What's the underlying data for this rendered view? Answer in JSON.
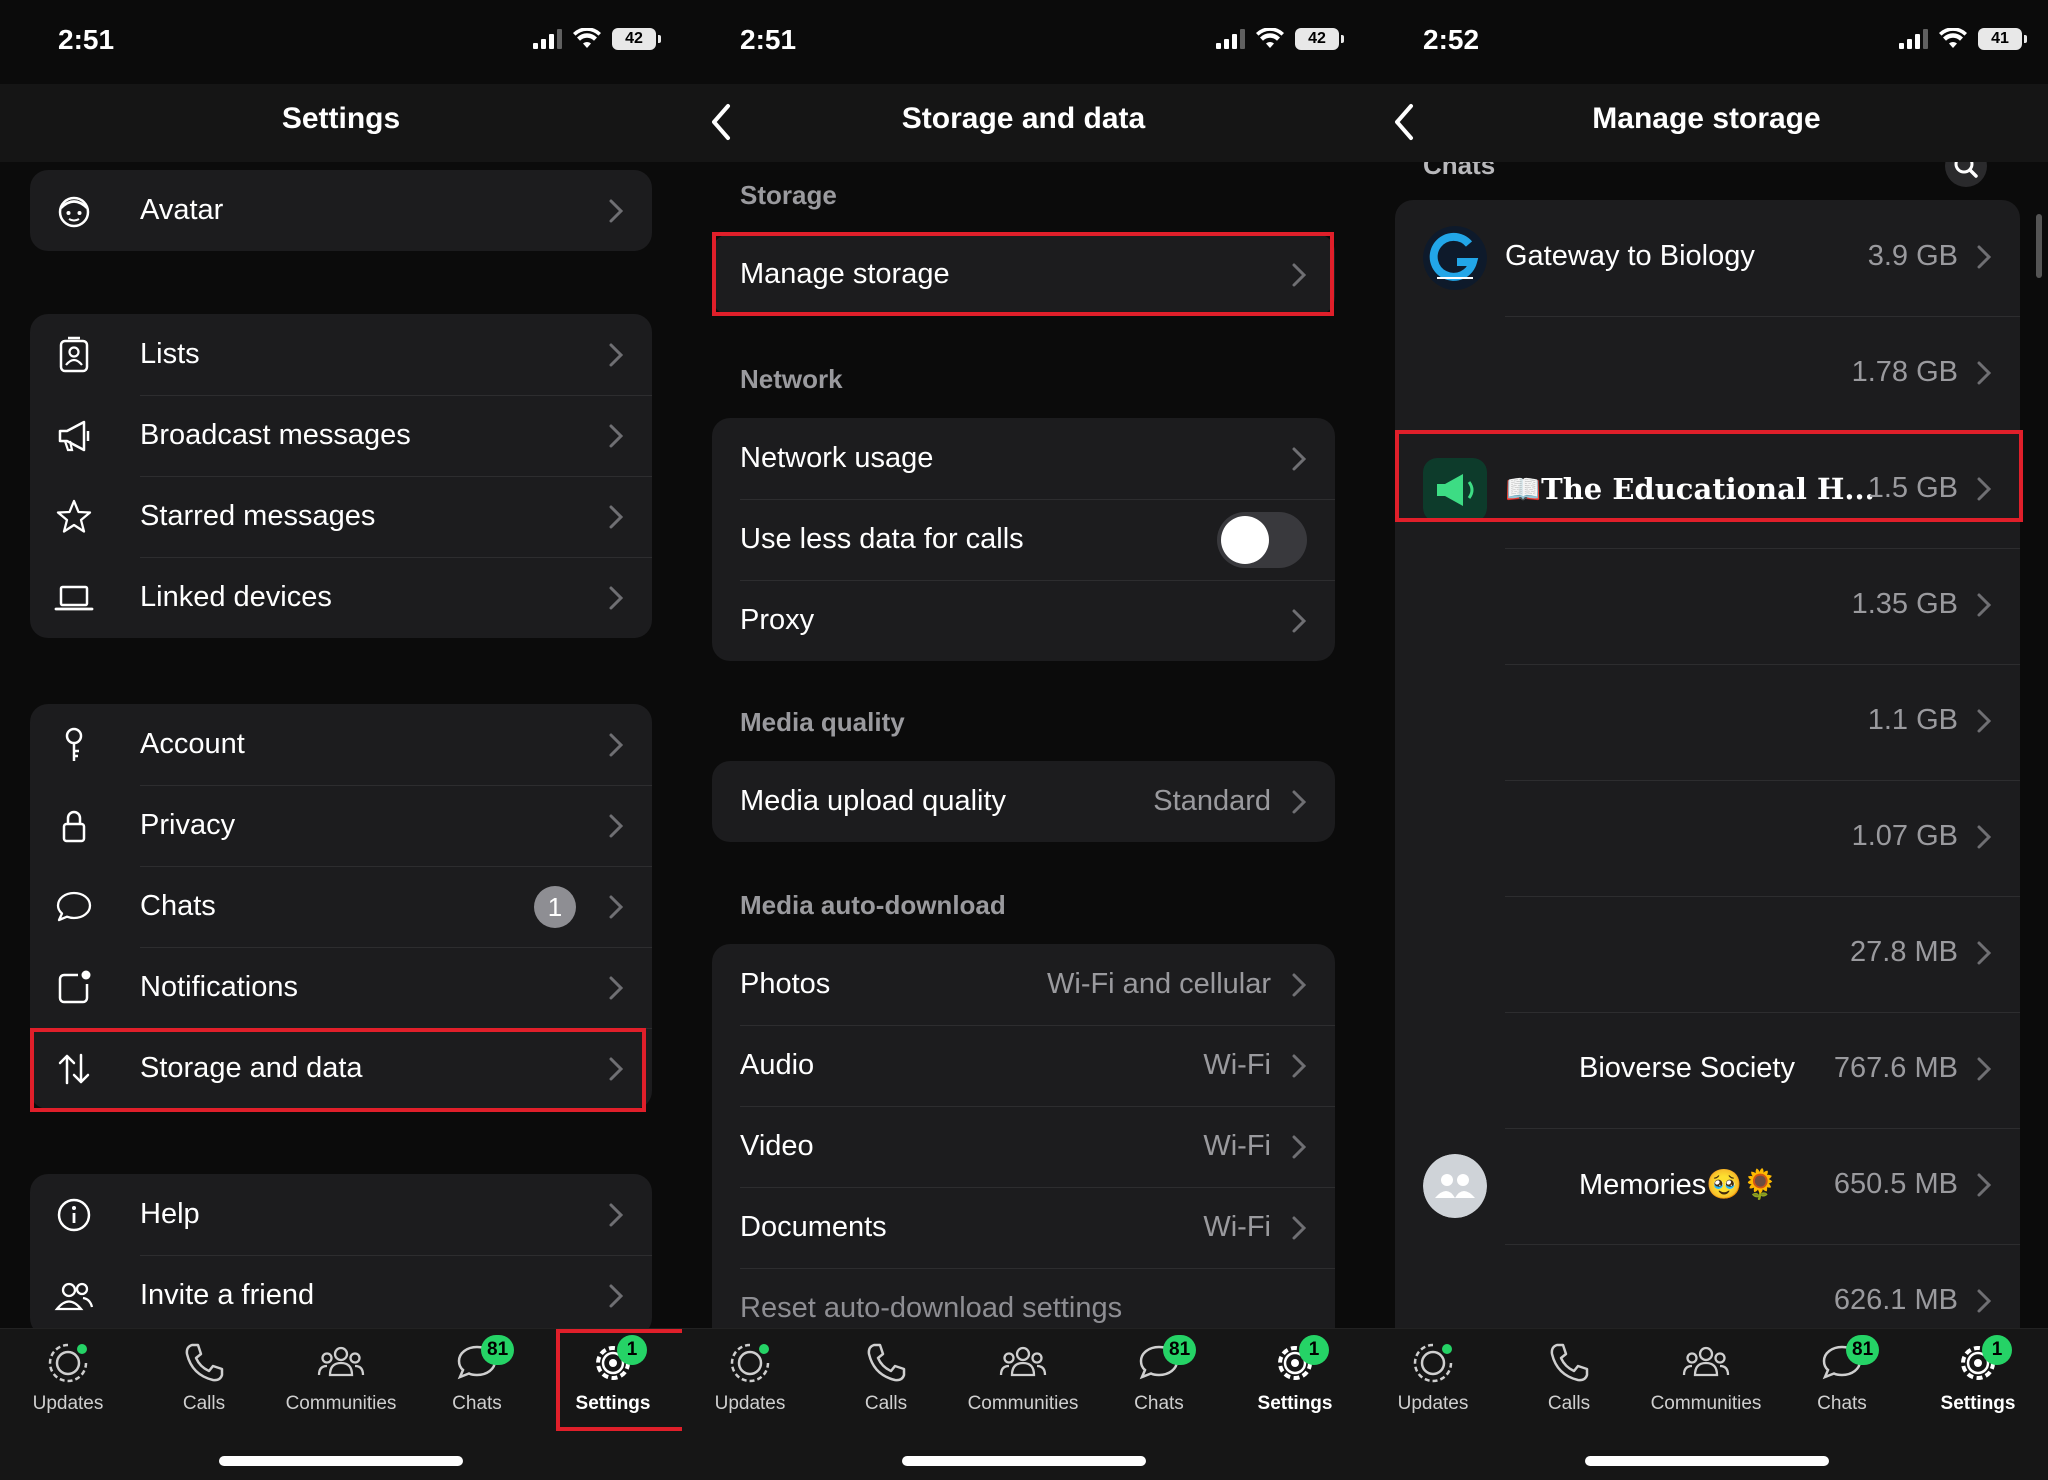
{
  "screens": [
    {
      "status": {
        "time": "2:51",
        "battery": "42"
      },
      "title": "Settings",
      "groups": [
        {
          "items": [
            {
              "label": "Avatar"
            }
          ]
        },
        {
          "items": [
            {
              "label": "Lists"
            },
            {
              "label": "Broadcast messages"
            },
            {
              "label": "Starred messages"
            },
            {
              "label": "Linked devices"
            }
          ]
        },
        {
          "items": [
            {
              "label": "Account"
            },
            {
              "label": "Privacy"
            },
            {
              "label": "Chats",
              "badge": "1"
            },
            {
              "label": "Notifications"
            },
            {
              "label": "Storage and data"
            }
          ]
        },
        {
          "items": [
            {
              "label": "Help"
            },
            {
              "label": "Invite a friend"
            }
          ]
        }
      ]
    },
    {
      "status": {
        "time": "2:51",
        "battery": "42"
      },
      "title": "Storage and data",
      "sections": {
        "storage": "Storage",
        "network": "Network",
        "media_quality": "Media quality",
        "auto_download": "Media auto-download"
      },
      "items": {
        "manage_storage": "Manage storage",
        "network_usage": "Network usage",
        "less_data": "Use less data for calls",
        "proxy": "Proxy",
        "upload_quality": {
          "label": "Media upload quality",
          "value": "Standard"
        },
        "photos": {
          "label": "Photos",
          "value": "Wi-Fi and cellular"
        },
        "audio": {
          "label": "Audio",
          "value": "Wi-Fi"
        },
        "video": {
          "label": "Video",
          "value": "Wi-Fi"
        },
        "documents": {
          "label": "Documents",
          "value": "Wi-Fi"
        },
        "reset": "Reset auto-download settings"
      }
    },
    {
      "status": {
        "time": "2:52",
        "battery": "41"
      },
      "title": "Manage storage",
      "section": "Chats",
      "chats": [
        {
          "name": "Gateway to Biology",
          "size": "3.9 GB"
        },
        {
          "name": "",
          "size": "1.78 GB"
        },
        {
          "name": "📖The Educational H...",
          "size": "1.5 GB"
        },
        {
          "name": "",
          "size": "1.35 GB"
        },
        {
          "name": "",
          "size": "1.1 GB"
        },
        {
          "name": "",
          "size": "1.07 GB"
        },
        {
          "name": "",
          "size": "27.8 MB"
        },
        {
          "name": "Bioverse Society",
          "size": "767.6 MB"
        },
        {
          "name": "Memories🥹🌻",
          "size": "650.5 MB"
        },
        {
          "name": "",
          "size": "626.1 MB"
        }
      ]
    }
  ],
  "tabbar": {
    "tabs": [
      "Updates",
      "Calls",
      "Communities",
      "Chats",
      "Settings"
    ],
    "chats_badge": "81",
    "settings_badge": "1"
  },
  "colors": {
    "highlight": "#e01f2a",
    "accent": "#25d366",
    "background": "#0b0b0b",
    "cell": "#1c1c1e"
  }
}
